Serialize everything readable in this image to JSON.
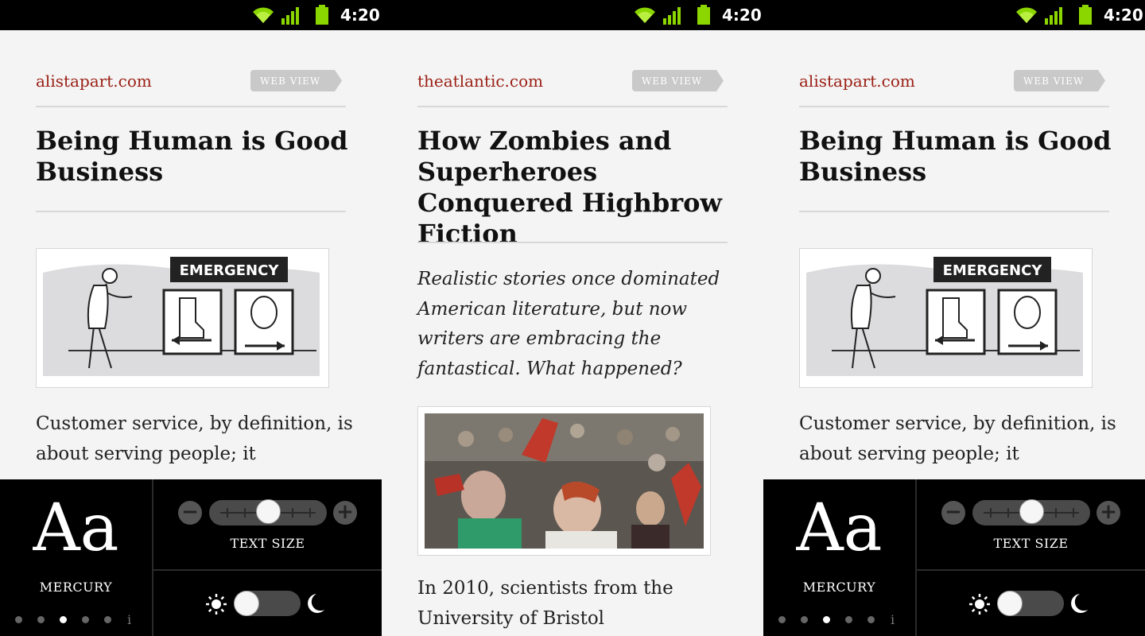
{
  "status_bar": {
    "time": "4:20"
  },
  "screens": [
    {
      "domain": "alistapart.com",
      "web_view_label": "WEB VIEW",
      "title": "Being Human is Good Business",
      "image_sign_text": "EMERGENCY",
      "body": "Customer service, by definition, is about serving people; it",
      "settings": {
        "font_sample": "Aa",
        "font_name": "MERCURY",
        "text_size_label": "TEXT SIZE",
        "text_size_level": 0.5,
        "minus_glyph": "−",
        "plus_glyph": "+",
        "page_dots": 5,
        "active_dot": 3,
        "info_glyph": "i",
        "night_mode": false
      }
    },
    {
      "domain": "theatlantic.com",
      "web_view_label": "WEB VIEW",
      "title": "How Zombies and Superheroes Conquered Highbrow Fiction",
      "dek": "Realistic stories once dominated American literature, but now writers are embracing the fantastical. What happened?",
      "body": "In 2010, scientists from the University of Bristol"
    },
    {
      "domain": "alistapart.com",
      "web_view_label": "WEB VIEW",
      "title": "Being Human is Good Business",
      "image_sign_text": "EMERGENCY",
      "body": "Customer service, by definition, is about serving people; it",
      "settings": {
        "font_sample": "Aa",
        "font_name": "MERCURY",
        "text_size_label": "TEXT SIZE",
        "text_size_level": 0.5,
        "minus_glyph": "−",
        "plus_glyph": "+",
        "page_dots": 5,
        "active_dot": 3,
        "info_glyph": "i",
        "night_mode": false
      }
    }
  ],
  "icons": {
    "wifi": "wifi-icon",
    "signal": "signal-icon",
    "battery": "battery-icon",
    "sun": "sun-icon",
    "moon": "moon-icon"
  },
  "colors": {
    "domain_link": "#9a1f14",
    "status_green": "#8cd600",
    "background": "#f4f4f4",
    "panel": "#000000"
  }
}
